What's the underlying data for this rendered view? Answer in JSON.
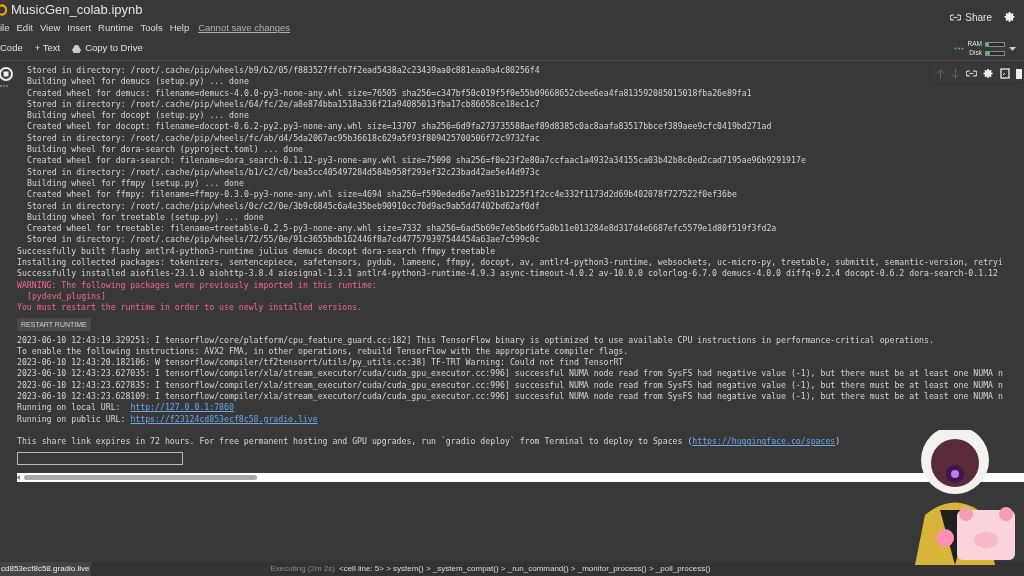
{
  "notebook": {
    "title": "MusicGen_colab.ipynb",
    "share": "Share"
  },
  "menu": [
    "ile",
    "Edit",
    "View",
    "Insert",
    "Runtime",
    "Tools",
    "Help"
  ],
  "save_notice": "Cannot save changes",
  "toolbar": {
    "code": "Code",
    "text": "+ Text",
    "copy": "Copy to Drive"
  },
  "resources": [
    {
      "label": "RAM",
      "level": 0.15
    },
    {
      "label": "Disk",
      "level": 0.2
    }
  ],
  "output": [
    {
      "kind": "sub",
      "text": "Stored in directory: /root/.cache/pip/wheels/b9/b2/05/f883527ffcb7f2ead5438a2c23439aa0c881eaa9a4c80256f4"
    },
    {
      "kind": "sub",
      "text": "Building wheel for demucs (setup.py) ... done"
    },
    {
      "kind": "sub",
      "text": "Created wheel for demucs: filename=demucs-4.0.0-py3-none-any.whl size=76505 sha256=c347bf50c019f5f0e55b09668652cbee6ea4fa813592085015018fba26e89fa1"
    },
    {
      "kind": "sub",
      "text": "Stored in directory: /root/.cache/pip/wheels/64/fc/2e/a8e874bba1518a336f21a94085013fba17cb86658ce18ec1c7"
    },
    {
      "kind": "sub",
      "text": "Building wheel for docopt (setup.py) ... done"
    },
    {
      "kind": "sub",
      "text": "Created wheel for docopt: filename=docopt-0.6.2-py2.py3-none-any.whl size=13707 sha256=6d9fa273735588aef89d8385c0ac8aafa83517bbcef389aee9cfc0419bd271ad"
    },
    {
      "kind": "sub",
      "text": "Stored in directory: /root/.cache/pip/wheels/fc/ab/d4/5da2067ac95b36618c629a5f93f809425700506f72c9732fac"
    },
    {
      "kind": "sub",
      "text": "Building wheel for dora-search (pyproject.toml) ... done"
    },
    {
      "kind": "sub",
      "text": "Created wheel for dora-search: filename=dora_search-0.1.12-py3-none-any.whl size=75090 sha256=f0e23f2e80a7ccfaac1a4932a34155ca03b42b8c0ed2cad7195ae96b9291917e"
    },
    {
      "kind": "sub",
      "text": "Stored in directory: /root/.cache/pip/wheels/b1/c2/c0/bea5cc405497284d584b958f293ef32c23bad42ae5e44d973c"
    },
    {
      "kind": "sub",
      "text": "Building wheel for ffmpy (setup.py) ... done"
    },
    {
      "kind": "sub",
      "text": "Created wheel for ffmpy: filename=ffmpy-0.3.0-py3-none-any.whl size=4694 sha256=f590eded6e7ae931b1225f1f2cc4e332f1173d2d69b402078f727522f0ef36be"
    },
    {
      "kind": "sub",
      "text": "Stored in directory: /root/.cache/pip/wheels/0c/c2/0e/3b9c6845c6a4e35beb90910cc70d9ac9ab5d47402bd62af0df"
    },
    {
      "kind": "sub",
      "text": "Building wheel for treetable (setup.py) ... done"
    },
    {
      "kind": "sub",
      "text": "Created wheel for treetable: filename=treetable-0.2.5-py3-none-any.whl size=7332 sha256=6ad5b69e7eb5bd6f5a0b11e013284e8d317d4e6687efc5579e1d80f519f3fd2a"
    },
    {
      "kind": "sub",
      "text": "Stored in directory: /root/.cache/pip/wheels/72/55/0e/91c3655bdb162446f8a7cd477579397544454a63ae7c599c0c"
    },
    {
      "kind": "plain",
      "text": "Successfully built flashy antlr4-python3-runtime julius demucs docopt dora-search ffmpy treetable"
    },
    {
      "kind": "plain",
      "text": "Installing collected packages: tokenizers, sentencepiece, safetensors, pydub, lameenc, ffmpy, docopt, av, antlr4-python3-runtime, websockets, uc-micro-py, treetable, submitit, semantic-version, retryi"
    },
    {
      "kind": "plain",
      "text": "Successfully installed aiofiles-23.1.0 aiohttp-3.8.4 aiosignal-1.3.1 antlr4-python3-runtime-4.9.3 async-timeout-4.0.2 av-10.0.0 colorlog-6.7.0 demucs-4.0.0 diffq-0.2.4 docopt-0.6.2 dora-search-0.1.12"
    },
    {
      "kind": "error",
      "text": "WARNING: The following packages were previously imported in this runtime:"
    },
    {
      "kind": "error_sub",
      "text": "[pydevd_plugins]"
    },
    {
      "kind": "error",
      "text": "You must restart the runtime in order to use newly installed versions."
    },
    {
      "kind": "button",
      "text": "RESTART RUNTIME"
    },
    {
      "kind": "plain",
      "text": "2023-06-10 12:43:19.329251: I tensorflow/core/platform/cpu_feature_guard.cc:182] This TensorFlow binary is optimized to use available CPU instructions in performance-critical operations."
    },
    {
      "kind": "plain",
      "text": "To enable the following instructions: AVX2 FMA, in other operations, rebuild TensorFlow with the appropriate compiler flags."
    },
    {
      "kind": "plain",
      "text": "2023-06-10 12:43:20.182106: W tensorflow/compiler/tf2tensorrt/utils/py_utils.cc:38] TF-TRT Warning: Could not find TensorRT"
    },
    {
      "kind": "plain",
      "text": "2023-06-10 12:43:23.627035: I tensorflow/compiler/xla/stream_executor/cuda/cuda_gpu_executor.cc:996] successful NUMA node read from SysFS had negative value (-1), but there must be at least one NUMA n"
    },
    {
      "kind": "plain",
      "text": "2023-06-10 12:43:23.627835: I tensorflow/compiler/xla/stream_executor/cuda/cuda_gpu_executor.cc:996] successful NUMA node read from SysFS had negative value (-1), but there must be at least one NUMA n"
    },
    {
      "kind": "plain",
      "text": "2023-06-10 12:43:23.628109: I tensorflow/compiler/xla/stream_executor/cuda/cuda_gpu_executor.cc:996] successful NUMA node read from SysFS had negative value (-1), but there must be at least one NUMA n"
    },
    {
      "kind": "link_line",
      "text": "Running on local URL:  ",
      "link": "http://127.0.0.1:7860"
    },
    {
      "kind": "link_line",
      "text": "Running on public URL: ",
      "link": "https://f23124cd853ecf8c58.gradio.live"
    },
    {
      "kind": "blank"
    },
    {
      "kind": "link_line",
      "text": "This share link expires in 72 hours. For free permanent hosting and GPU upgrades, run `gradio deploy` from Terminal to deploy to Spaces (",
      "link": "https://huggingface.co/spaces",
      "after": ")"
    }
  ],
  "status": {
    "url": "cd853ecf8c58.gradio.live",
    "executing": "Executing (2m 2s)",
    "trace": "<cell line: 5> > system() > _system_compat() > _run_command() > _monitor_process() > _poll_process()"
  }
}
